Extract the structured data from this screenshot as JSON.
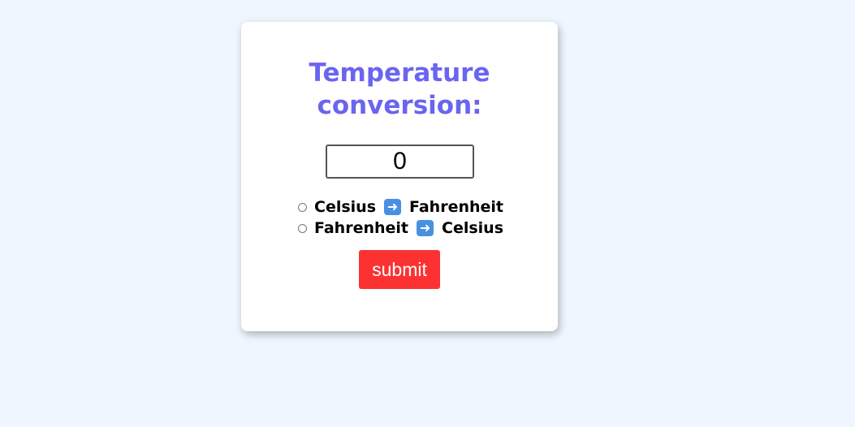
{
  "card": {
    "title": "Temperature conversion:",
    "input": {
      "value": "0"
    },
    "options": [
      {
        "from": "Celsius",
        "to": "Fahrenheit",
        "icon": "right-arrow-icon",
        "selected": false
      },
      {
        "from": "Fahrenheit",
        "to": "Celsius",
        "icon": "right-arrow-icon",
        "selected": false
      }
    ],
    "submit_label": "submit"
  },
  "colors": {
    "background": "#eef6ff",
    "title": "#6a65f0",
    "submit": "#fc3232",
    "arrow_icon": "#4a90e2"
  }
}
